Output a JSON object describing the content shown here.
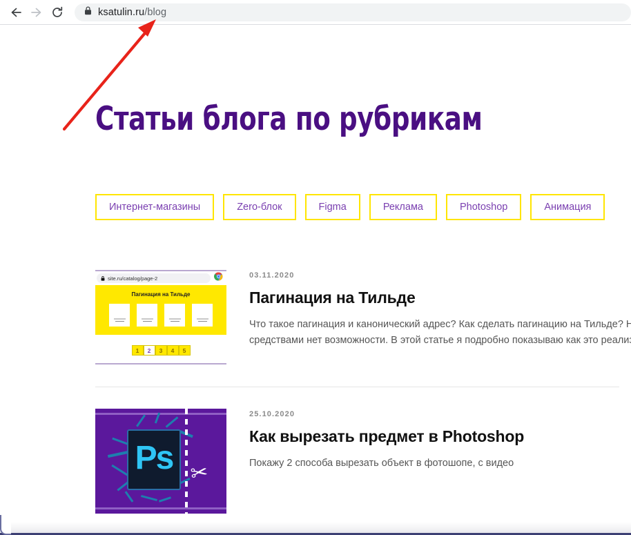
{
  "browser": {
    "back_icon": "arrow-left-icon",
    "forward_icon": "arrow-right-icon",
    "reload_icon": "reload-icon",
    "lock_icon": "lock-icon",
    "url_domain": "ksatulin.ru",
    "url_path": "/blog"
  },
  "page": {
    "title": "Статьи блога по рубрикам",
    "chips": [
      {
        "label": "Интернет-магазины"
      },
      {
        "label": "Zero-блок"
      },
      {
        "label": "Figma"
      },
      {
        "label": "Реклама"
      },
      {
        "label": "Photoshop"
      },
      {
        "label": "Анимация"
      }
    ],
    "articles": [
      {
        "date": "03.11.2020",
        "title": "Пагинация на Тильде",
        "text_line1": "Что такое пагинация и канонический адрес? Как сделать пагинацию на Тильде? На",
        "text_line2": "средствами нет возможности. В этой статье я подробно показываю как это реализо",
        "thumb": {
          "kind": "tilda-pagination-mock",
          "mock_url": "site.ru/catalog/page-2",
          "mock_lock_icon": "lock-icon",
          "mock_browser_icon": "chrome-logo-icon",
          "mock_heading": "Пагинация на Тильде",
          "pager": [
            "1",
            "2",
            "3",
            "4",
            "5"
          ],
          "pager_active": "2"
        }
      },
      {
        "date": "25.10.2020",
        "title": "Как вырезать предмет в Photoshop",
        "text_line1": "Покажу 2 способа вырезать объект в фотошопе, с видео",
        "text_line2": "",
        "thumb": {
          "kind": "photoshop-art",
          "logo_letters": "Ps",
          "scissors_icon": "scissors-icon"
        }
      }
    ]
  },
  "annotation": {
    "arrow_icon": "red-arrow-icon",
    "color": "#e8231a"
  },
  "colors": {
    "heading_purple": "#4a0f82",
    "chip_yellow": "#ffe500",
    "chip_text_purple": "#7a3fb0",
    "ps_purple": "#5b189c",
    "ps_cyan": "#2fc5f5"
  }
}
